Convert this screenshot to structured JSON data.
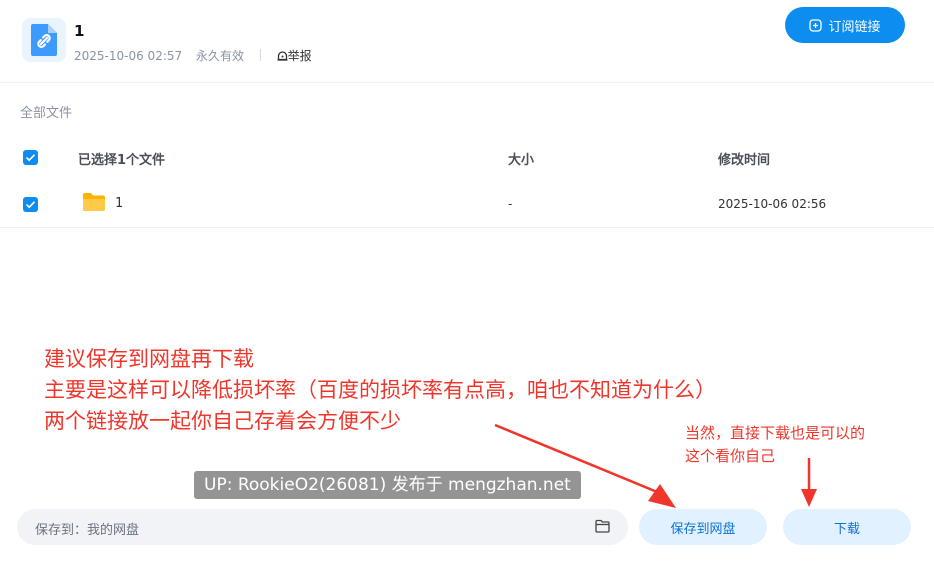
{
  "header": {
    "title": "1",
    "date": "2025-10-06 02:57",
    "validity": "永久有效",
    "report_label": "举报",
    "subscribe_label": "订阅链接"
  },
  "breadcrumb": "全部文件",
  "table": {
    "columns": [
      "已选择1个文件",
      "大小",
      "修改时间"
    ],
    "rows": [
      {
        "name": "1",
        "size": "-",
        "modified": "2025-10-06 02:56",
        "checked": true
      }
    ]
  },
  "annotations": {
    "main": [
      "建议保存到网盘再下载",
      "主要是这样可以降低损坏率（百度的损坏率有点高，咱也不知道为什么）",
      "两个链接放一起你自己存着会方便不少"
    ],
    "side": [
      "当然，直接下载也是可以的",
      "这个看你自己"
    ],
    "color": "#f0352b"
  },
  "watermark": "UP: RookieO2(26081) 发布于 mengzhan.net",
  "footer": {
    "save_to_label": "保存到：我的网盘",
    "save_button": "保存到网盘",
    "download_button": "下载"
  },
  "colors": {
    "accent": "#0d8df0",
    "pill_bg": "#e1f1ff",
    "folder": "#ffc53d"
  }
}
